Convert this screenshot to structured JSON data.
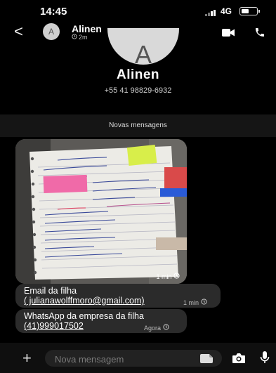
{
  "status_bar": {
    "time": "14:45",
    "network": "4G"
  },
  "header": {
    "back_glyph": "<",
    "avatar_initial": "A",
    "contact_name": "Alinen",
    "subtitle_time": "2m"
  },
  "profile": {
    "avatar_initial": "A",
    "name": "Alinen",
    "phone": "+55 41 98829-6932"
  },
  "separator": {
    "label": "Novas mensagens"
  },
  "messages": [
    {
      "type": "image",
      "time": "1 min"
    },
    {
      "type": "text",
      "line1": "Email da filha",
      "line2": "( julianawolffmoro@gmail.com)",
      "time": "1 min"
    },
    {
      "type": "text",
      "line1": "WhatsApp da empresa da filha",
      "line2": "(41)999017502",
      "time": "Agora"
    }
  ],
  "composer": {
    "plus_glyph": "+",
    "placeholder": "Nova mensagem"
  },
  "colors": {
    "background": "#000000",
    "bubble": "#2b2b2b",
    "separator": "#151515"
  }
}
